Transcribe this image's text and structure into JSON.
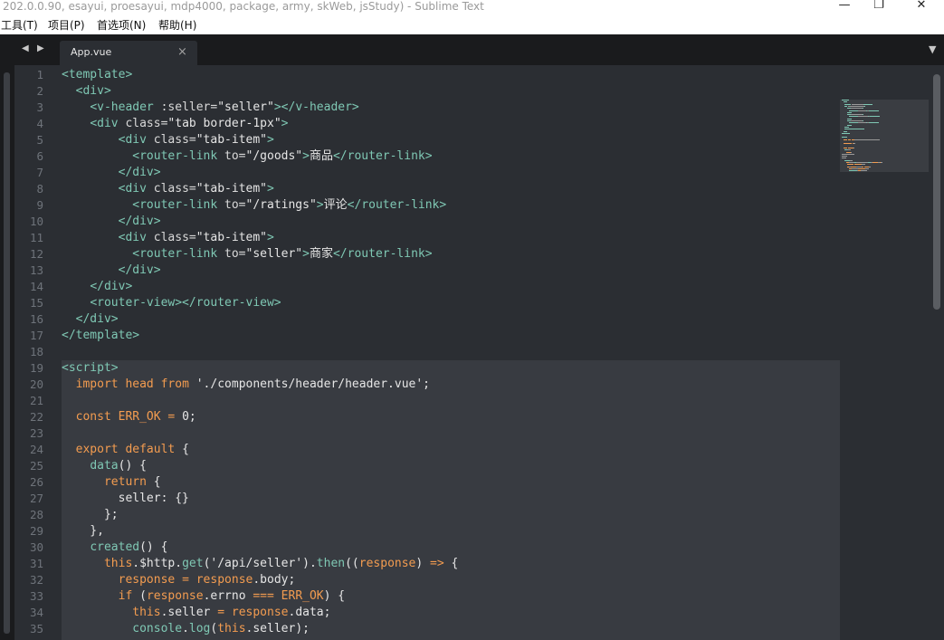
{
  "window": {
    "title": "202.0.0.90, esayui, proesayui, mdp4000, package, army, skWeb, jsStudy) - Sublime Text",
    "minimize": "—",
    "maximize": "❐",
    "close": "✕"
  },
  "menu": [
    "工具(T)",
    "项目(P)",
    "首选项(N)",
    "帮助(H)"
  ],
  "tabs": [
    {
      "label": "App.vue",
      "close": "×"
    }
  ],
  "nav": {
    "back": "◀",
    "forward": "▶",
    "dropdown": "▼"
  },
  "colors": {
    "editor_bg": "#2b2e33",
    "tag": "#7fc8b4",
    "keyword": "#f39c50",
    "text": "#e6e6e6",
    "gutter": "#6e737a"
  },
  "code": {
    "line_numbers": [
      "1",
      "2",
      "3",
      "4",
      "5",
      "6",
      "7",
      "8",
      "9",
      "10",
      "11",
      "12",
      "13",
      "14",
      "15",
      "16",
      "17",
      "18",
      "19",
      "20",
      "21",
      "22",
      "23",
      "24",
      "25",
      "26",
      "27",
      "28",
      "29",
      "30",
      "31",
      "32",
      "33",
      "34",
      "35"
    ],
    "lines": [
      [
        [
          "t",
          "<template>"
        ]
      ],
      [
        [
          "p",
          "  "
        ],
        [
          "t",
          "<div>"
        ]
      ],
      [
        [
          "p",
          "    "
        ],
        [
          "t",
          "<v-header"
        ],
        [
          "p",
          " "
        ],
        [
          "a",
          ":seller="
        ],
        [
          "s",
          "\"seller\""
        ],
        [
          "t",
          "></v-header>"
        ]
      ],
      [
        [
          "p",
          "    "
        ],
        [
          "t",
          "<div"
        ],
        [
          "p",
          " "
        ],
        [
          "a",
          "class="
        ],
        [
          "s",
          "\"tab border-1px\""
        ],
        [
          "t",
          ">"
        ]
      ],
      [
        [
          "p",
          "        "
        ],
        [
          "t",
          "<div"
        ],
        [
          "p",
          " "
        ],
        [
          "a",
          "class="
        ],
        [
          "s",
          "\"tab-item\""
        ],
        [
          "t",
          ">"
        ]
      ],
      [
        [
          "p",
          "          "
        ],
        [
          "t",
          "<router-link"
        ],
        [
          "p",
          " "
        ],
        [
          "a",
          "to="
        ],
        [
          "s",
          "\"/goods\""
        ],
        [
          "t",
          ">"
        ],
        [
          "p",
          "商品"
        ],
        [
          "t",
          "</router-link>"
        ]
      ],
      [
        [
          "p",
          "        "
        ],
        [
          "t",
          "</div>"
        ]
      ],
      [
        [
          "p",
          "        "
        ],
        [
          "t",
          "<div"
        ],
        [
          "p",
          " "
        ],
        [
          "a",
          "class="
        ],
        [
          "s",
          "\"tab-item\""
        ],
        [
          "t",
          ">"
        ]
      ],
      [
        [
          "p",
          "          "
        ],
        [
          "t",
          "<router-link"
        ],
        [
          "p",
          " "
        ],
        [
          "a",
          "to="
        ],
        [
          "s",
          "\"/ratings\""
        ],
        [
          "t",
          ">"
        ],
        [
          "p",
          "评论"
        ],
        [
          "t",
          "</router-link>"
        ]
      ],
      [
        [
          "p",
          "        "
        ],
        [
          "t",
          "</div>"
        ]
      ],
      [
        [
          "p",
          "        "
        ],
        [
          "t",
          "<div"
        ],
        [
          "p",
          " "
        ],
        [
          "a",
          "class="
        ],
        [
          "s",
          "\"tab-item\""
        ],
        [
          "t",
          ">"
        ]
      ],
      [
        [
          "p",
          "          "
        ],
        [
          "t",
          "<router-link"
        ],
        [
          "p",
          " "
        ],
        [
          "a",
          "to="
        ],
        [
          "s",
          "\"seller\""
        ],
        [
          "t",
          ">"
        ],
        [
          "p",
          "商家"
        ],
        [
          "t",
          "</router-link>"
        ]
      ],
      [
        [
          "p",
          "        "
        ],
        [
          "t",
          "</div>"
        ]
      ],
      [
        [
          "p",
          "    "
        ],
        [
          "t",
          "</div>"
        ]
      ],
      [
        [
          "p",
          "    "
        ],
        [
          "t",
          "<router-view></router-view>"
        ]
      ],
      [
        [
          "p",
          "  "
        ],
        [
          "t",
          "</div>"
        ]
      ],
      [
        [
          "t",
          "</template>"
        ]
      ],
      [],
      [
        [
          "t",
          "<script>"
        ]
      ],
      [
        [
          "p",
          "  "
        ],
        [
          "k",
          "import"
        ],
        [
          "p",
          " "
        ],
        [
          "v",
          "head"
        ],
        [
          "p",
          " "
        ],
        [
          "k",
          "from"
        ],
        [
          "p",
          " './components/header/header.vue';"
        ]
      ],
      [],
      [
        [
          "p",
          "  "
        ],
        [
          "k",
          "const"
        ],
        [
          "p",
          " "
        ],
        [
          "v",
          "ERR_OK"
        ],
        [
          "p",
          " "
        ],
        [
          "k",
          "="
        ],
        [
          "p",
          " 0;"
        ]
      ],
      [],
      [
        [
          "p",
          "  "
        ],
        [
          "k",
          "export"
        ],
        [
          "p",
          " "
        ],
        [
          "k",
          "default"
        ],
        [
          "p",
          " {"
        ]
      ],
      [
        [
          "p",
          "    "
        ],
        [
          "f",
          "data"
        ],
        [
          "p",
          "() {"
        ]
      ],
      [
        [
          "p",
          "      "
        ],
        [
          "k",
          "return"
        ],
        [
          "p",
          " {"
        ]
      ],
      [
        [
          "p",
          "        seller: {}"
        ]
      ],
      [
        [
          "p",
          "      };"
        ]
      ],
      [
        [
          "p",
          "    },"
        ]
      ],
      [
        [
          "p",
          "    "
        ],
        [
          "f",
          "created"
        ],
        [
          "p",
          "() {"
        ]
      ],
      [
        [
          "p",
          "      "
        ],
        [
          "k",
          "this"
        ],
        [
          "p",
          ".$http."
        ],
        [
          "f",
          "get"
        ],
        [
          "p",
          "('/api/seller')."
        ],
        [
          "f",
          "then"
        ],
        [
          "p",
          "(("
        ],
        [
          "v",
          "response"
        ],
        [
          "p",
          ") "
        ],
        [
          "k",
          "=>"
        ],
        [
          "p",
          " {"
        ]
      ],
      [
        [
          "p",
          "        "
        ],
        [
          "v",
          "response"
        ],
        [
          "p",
          " "
        ],
        [
          "k",
          "="
        ],
        [
          "p",
          " "
        ],
        [
          "v",
          "response"
        ],
        [
          "p",
          ".body;"
        ]
      ],
      [
        [
          "p",
          "        "
        ],
        [
          "k",
          "if"
        ],
        [
          "p",
          " ("
        ],
        [
          "v",
          "response"
        ],
        [
          "p",
          ".errno "
        ],
        [
          "k",
          "==="
        ],
        [
          "p",
          " "
        ],
        [
          "v",
          "ERR_OK"
        ],
        [
          "p",
          ") {"
        ]
      ],
      [
        [
          "p",
          "          "
        ],
        [
          "k",
          "this"
        ],
        [
          "p",
          ".seller "
        ],
        [
          "k",
          "="
        ],
        [
          "p",
          " "
        ],
        [
          "v",
          "response"
        ],
        [
          "p",
          ".data;"
        ]
      ],
      [
        [
          "p",
          "          "
        ],
        [
          "f",
          "console"
        ],
        [
          "p",
          "."
        ],
        [
          "f",
          "log"
        ],
        [
          "p",
          "("
        ],
        [
          "k",
          "this"
        ],
        [
          "p",
          ".seller);"
        ]
      ]
    ]
  }
}
